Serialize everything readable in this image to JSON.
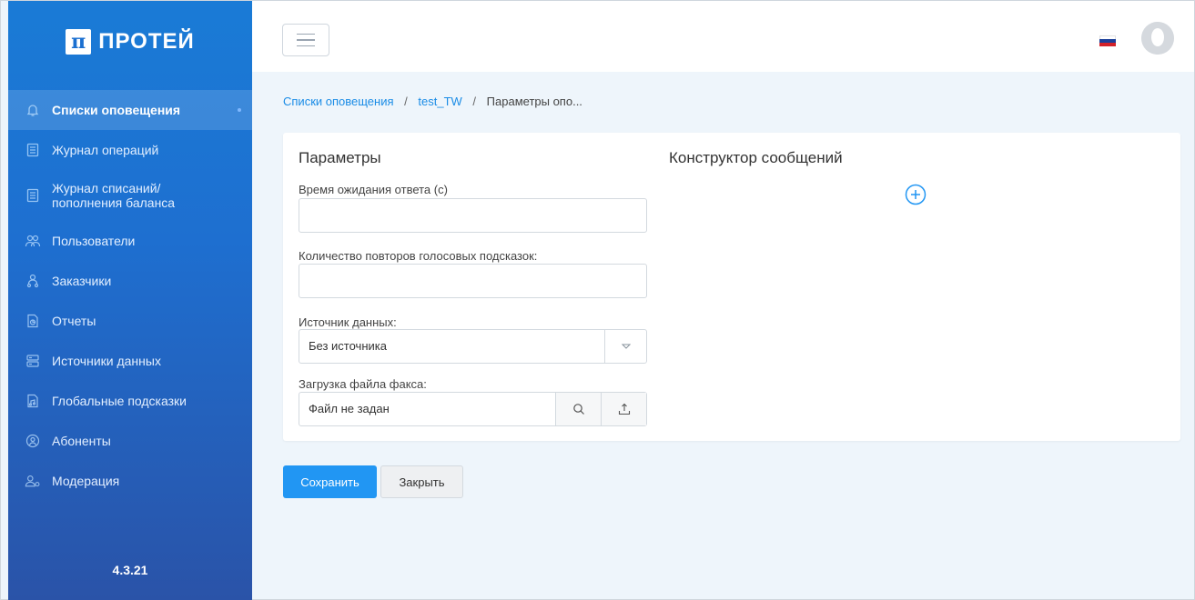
{
  "app": {
    "logo_text": "ПРОТЕЙ",
    "logo_mark": "π",
    "version": "4.3.21"
  },
  "sidebar": {
    "items": [
      {
        "label": "Списки оповещения",
        "icon": "bell-icon",
        "active": true
      },
      {
        "label": "Журнал операций",
        "icon": "document-list-icon"
      },
      {
        "label": "Журнал списаний/\nпополнения баланса",
        "icon": "document-list-icon"
      },
      {
        "label": "Пользователи",
        "icon": "users-icon"
      },
      {
        "label": "Заказчики",
        "icon": "customers-icon"
      },
      {
        "label": "Отчеты",
        "icon": "report-icon"
      },
      {
        "label": "Источники данных",
        "icon": "database-icon"
      },
      {
        "label": "Глобальные подсказки",
        "icon": "audio-file-icon"
      },
      {
        "label": "Абоненты",
        "icon": "user-circle-icon"
      },
      {
        "label": "Модерация",
        "icon": "user-moderation-icon"
      }
    ]
  },
  "header": {
    "flag": "russia-flag",
    "colors": {
      "flag_white": "#ffffff",
      "flag_blue": "#1c3f9a",
      "flag_red": "#d2212a"
    }
  },
  "breadcrumb": {
    "items": [
      "Списки оповещения",
      "test_TW"
    ],
    "current": "Параметры опо...",
    "separator": "/"
  },
  "params": {
    "title": "Параметры",
    "response_timeout_label": "Время ожидания ответа (с)",
    "response_timeout_value": "",
    "repeat_count_label": "Количество повторов голосовых подсказок:",
    "repeat_count_value": "",
    "data_source_label": "Источник данных:",
    "data_source_value": "Без источника",
    "fax_upload_label": "Загрузка файла факса:",
    "fax_upload_value": "Файл не задан"
  },
  "constructor": {
    "title": "Конструктор сообщений"
  },
  "actions": {
    "save_label": "Сохранить",
    "close_label": "Закрыть"
  },
  "colors": {
    "accent": "#2196f3",
    "link": "#1a8ce6",
    "sidebar_top": "#1a7bd6",
    "sidebar_bottom": "#2a53a8"
  }
}
